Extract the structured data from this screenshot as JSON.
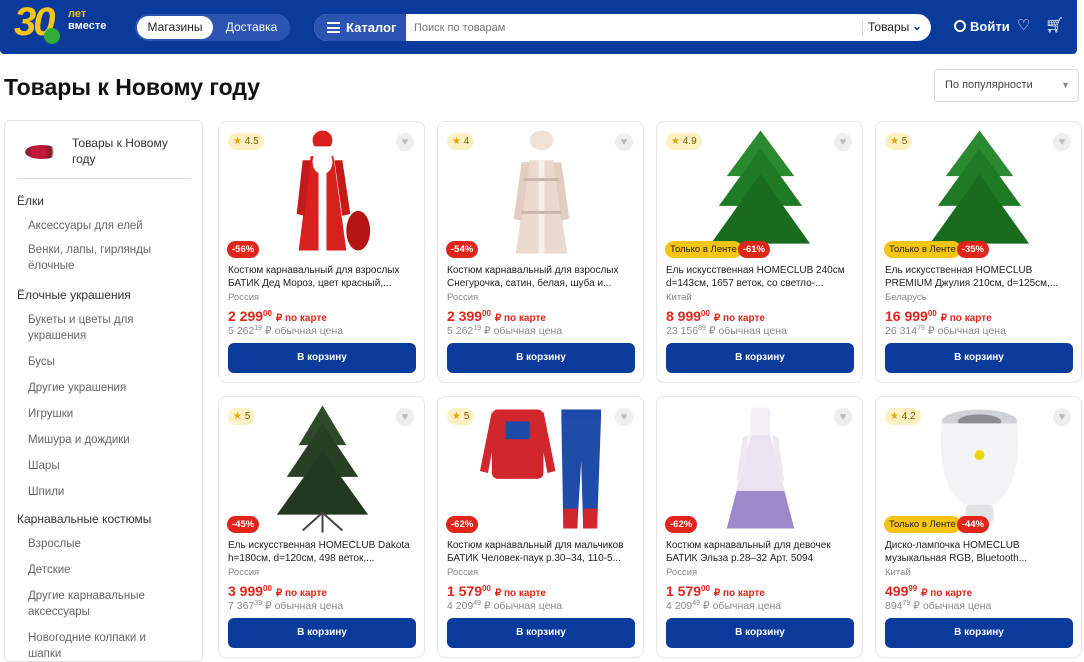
{
  "header": {
    "logo_number": "30",
    "logo_line1": "лет",
    "logo_line2": "вместе",
    "tab_stores": "Магазины",
    "tab_delivery": "Доставка",
    "catalog_label": "Каталог",
    "search_placeholder": "Поиск по товарам",
    "search_scope": "Товары",
    "login_label": "Войти",
    "colors": {
      "brand": "#0a3a9c",
      "accent": "#f6c413",
      "sale": "#e1251b"
    }
  },
  "page": {
    "title": "Товары к Новому году",
    "sort_label": "По популярности"
  },
  "sidebar": {
    "title": "Товары к Новому году",
    "items": [
      {
        "label": "Ёлки",
        "level": 1
      },
      {
        "label": "Аксессуары для елей",
        "level": 2
      },
      {
        "label": "Венки, лапы, гирлянды ёлочные",
        "level": 2
      },
      {
        "label": "Ёлочные украшения",
        "level": 1
      },
      {
        "label": "Букеты и цветы для украшения",
        "level": 2
      },
      {
        "label": "Бусы",
        "level": 2
      },
      {
        "label": "Другие украшения",
        "level": 2
      },
      {
        "label": "Игрушки",
        "level": 2
      },
      {
        "label": "Мишура и дождики",
        "level": 2
      },
      {
        "label": "Шары",
        "level": 2
      },
      {
        "label": "Шпили",
        "level": 2
      },
      {
        "label": "Карнавальные костюмы",
        "level": 1
      },
      {
        "label": "Взрослые",
        "level": 2
      },
      {
        "label": "Детские",
        "level": 2
      },
      {
        "label": "Другие карнавальные аксессуары",
        "level": 2
      },
      {
        "label": "Новогодние колпаки и шапки",
        "level": 2
      }
    ]
  },
  "products": [
    {
      "rating": "4.5",
      "only": "",
      "discount": "-56%",
      "name": "Костюм карнавальный для взрослых БАТИК Дед Мороз, цвет красный,...",
      "country": "Россия",
      "price_main": "2 299",
      "price_kop": "00",
      "price_suffix": "₽ по карте",
      "old_main": "5 262",
      "old_kop": "19",
      "old_suffix": "₽ обычная цена",
      "button": "В корзину",
      "image": "ded-moroz-costume"
    },
    {
      "rating": "4",
      "only": "",
      "discount": "-54%",
      "name": "Костюм карнавальный для взрослых Снегурочка, сатин, белая, шуба и...",
      "country": "Россия",
      "price_main": "2 399",
      "price_kop": "00",
      "price_suffix": "₽ по карте",
      "old_main": "5 262",
      "old_kop": "19",
      "old_suffix": "₽ обычная цена",
      "button": "В корзину",
      "image": "snegurochka-costume"
    },
    {
      "rating": "4.9",
      "only": "Только в Ленте",
      "discount": "-61%",
      "name": "Ель искусственная HOMECLUB 240см d=143см, 1657 веток, со светло-...",
      "country": "Китай",
      "price_main": "8 999",
      "price_kop": "00",
      "price_suffix": "₽ по карте",
      "old_main": "23 156",
      "old_kop": "89",
      "old_suffix": "₽ обычная цена",
      "button": "В корзину",
      "image": "green-tree"
    },
    {
      "rating": "5",
      "only": "Только в Ленте",
      "discount": "-35%",
      "name": "Ель искусственная HOMECLUB PREMIUM Джулия 210см, d=125см,...",
      "country": "Беларусь",
      "price_main": "16 999",
      "price_kop": "00",
      "price_suffix": "₽ по карте",
      "old_main": "26 314",
      "old_kop": "79",
      "old_suffix": "₽ обычная цена",
      "button": "В корзину",
      "image": "green-tree"
    },
    {
      "rating": "5",
      "only": "",
      "discount": "-45%",
      "name": "Ель искусственная HOMECLUB Dakota h=180см, d=120см, 498 веток,...",
      "country": "Россия",
      "price_main": "3 999",
      "price_kop": "00",
      "price_suffix": "₽ по карте",
      "old_main": "7 367",
      "old_kop": "39",
      "old_suffix": "₽ обычная цена",
      "button": "В корзину",
      "image": "dark-tree"
    },
    {
      "rating": "5",
      "only": "",
      "discount": "-62%",
      "name": "Костюм карнавальный для мальчиков БАТИК Человек-паук р.30–34, 110-5...",
      "country": "Россия",
      "price_main": "1 579",
      "price_kop": "00",
      "price_suffix": "₽ по карте",
      "old_main": "4 209",
      "old_kop": "49",
      "old_suffix": "₽ обычная цена",
      "button": "В корзину",
      "image": "spiderman-costume"
    },
    {
      "rating": "",
      "only": "",
      "discount": "-62%",
      "name": "Костюм карнавальный для девочек БАТИК Эльза р.28–32 Арт. 5094",
      "country": "Россия",
      "price_main": "1 579",
      "price_kop": "00",
      "price_suffix": "₽ по карте",
      "old_main": "4 209",
      "old_kop": "49",
      "old_suffix": "₽ обычная цена",
      "button": "В корзину",
      "image": "elsa-dress"
    },
    {
      "rating": "4.2",
      "only": "Только в Ленте",
      "discount": "-44%",
      "name": "Диско-лампочка HOMECLUB музыкальная RGB, Bluetooth...",
      "country": "Китай",
      "price_main": "499",
      "price_kop": "99",
      "price_suffix": "₽ по карте",
      "old_main": "894",
      "old_kop": "79",
      "old_suffix": "₽ обычная цена",
      "button": "В корзину",
      "image": "disco-bulb"
    }
  ]
}
